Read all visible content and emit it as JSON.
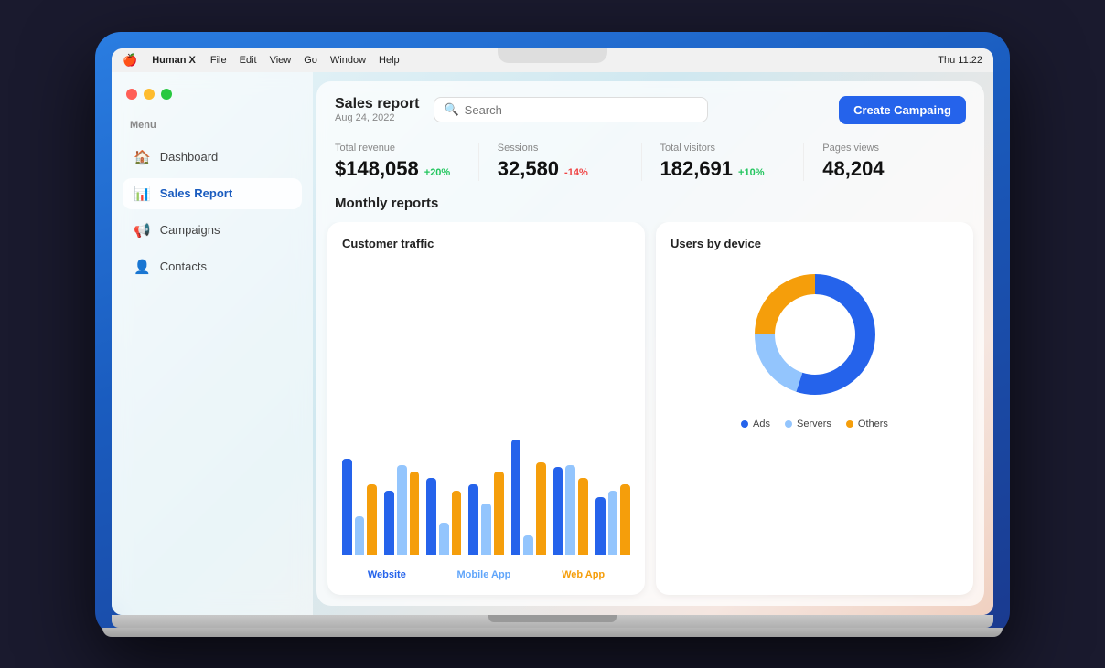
{
  "menubar": {
    "apple": "🍎",
    "app": "Human X",
    "items": [
      "File",
      "Edit",
      "View",
      "Go",
      "Window",
      "Help"
    ],
    "right": "Thu 11:22"
  },
  "window_controls": {
    "close": "close",
    "minimize": "minimize",
    "maximize": "maximize"
  },
  "sidebar": {
    "menu_label": "Menu",
    "items": [
      {
        "id": "dashboard",
        "label": "Dashboard",
        "icon": "🏠",
        "active": false
      },
      {
        "id": "sales-report",
        "label": "Sales Report",
        "icon": "📊",
        "active": true
      },
      {
        "id": "campaigns",
        "label": "Campaigns",
        "icon": "📢",
        "active": false
      },
      {
        "id": "contacts",
        "label": "Contacts",
        "icon": "👤",
        "active": false
      }
    ]
  },
  "header": {
    "title": "Sales report",
    "subtitle": "Aug 24, 2022",
    "search_placeholder": "Search",
    "create_button": "Create Campaing"
  },
  "stats": [
    {
      "label": "Total revenue",
      "value": "$148,058",
      "change": "+20%",
      "positive": true
    },
    {
      "label": "Sessions",
      "value": "32,580",
      "change": "-14%",
      "positive": false
    },
    {
      "label": "Total visitors",
      "value": "182,691",
      "change": "+10%",
      "positive": true
    },
    {
      "label": "Pages views",
      "value": "48,204",
      "change": "",
      "positive": true
    }
  ],
  "monthly_reports": {
    "title": "Monthly reports"
  },
  "customer_traffic": {
    "title": "Customer traffic",
    "bars": [
      {
        "website": 75,
        "mobile": 30,
        "web": 55
      },
      {
        "website": 50,
        "mobile": 70,
        "web": 65
      },
      {
        "website": 60,
        "mobile": 25,
        "web": 50
      },
      {
        "website": 55,
        "mobile": 40,
        "web": 65
      },
      {
        "website": 90,
        "mobile": 15,
        "web": 72
      },
      {
        "website": 68,
        "mobile": 70,
        "web": 60
      },
      {
        "website": 45,
        "mobile": 50,
        "web": 55
      }
    ],
    "legends": [
      {
        "label": "Website",
        "color": "#2563eb"
      },
      {
        "label": "Mobile App",
        "color": "#60a5fa"
      },
      {
        "label": "Web App",
        "color": "#f59e0b"
      }
    ]
  },
  "users_by_device": {
    "title": "Users by device",
    "segments": [
      {
        "label": "Ads",
        "color": "#2563eb",
        "value": 55,
        "dot_color": "#2563eb"
      },
      {
        "label": "Servers",
        "color": "#93c5fd",
        "value": 20,
        "dot_color": "#93c5fd"
      },
      {
        "label": "Others",
        "color": "#f59e0b",
        "value": 25,
        "dot_color": "#f59e0b"
      }
    ]
  }
}
